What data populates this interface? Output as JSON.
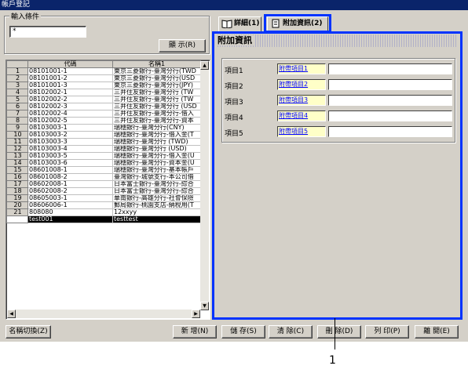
{
  "window": {
    "title": "帳戶登記"
  },
  "filter": {
    "group_title": "輸入條件",
    "value": "*",
    "display_button": "顯 示(R)"
  },
  "grid": {
    "headers": [
      "代碼",
      "名稱1"
    ],
    "rows": [
      {
        "num": "1",
        "code": "08101001-1",
        "name": "東京三菱銀行-臺灣分行(TWD"
      },
      {
        "num": "2",
        "code": "08101001-2",
        "name": "東京三菱銀行-臺灣分行(USD"
      },
      {
        "num": "3",
        "code": "08101001-3",
        "name": "東京三菱銀行-臺灣分行(JPY)"
      },
      {
        "num": "4",
        "code": "08102002-1",
        "name": "三井住友銀行-臺灣分行 (TW"
      },
      {
        "num": "5",
        "code": "08102002-2",
        "name": "三井住友銀行-臺灣分行 (TW"
      },
      {
        "num": "6",
        "code": "08102002-3",
        "name": "三井住友銀行-臺灣分行 (USD"
      },
      {
        "num": "7",
        "code": "08102002-4",
        "name": "三井住友銀行-臺灣分行-借入"
      },
      {
        "num": "8",
        "code": "08102002-5",
        "name": "三井住友銀行-臺灣分行-資本"
      },
      {
        "num": "9",
        "code": "08103003-1",
        "name": "瑞穗銀行-臺灣分行(CNY)"
      },
      {
        "num": "10",
        "code": "08103003-2",
        "name": "瑞穗銀行-臺灣分行-借入金(T"
      },
      {
        "num": "11",
        "code": "08103003-3",
        "name": "瑞穗銀行-臺灣分行 (TWD)"
      },
      {
        "num": "12",
        "code": "08103003-4",
        "name": "瑞穗銀行-臺灣分行 (USD)"
      },
      {
        "num": "13",
        "code": "08103003-5",
        "name": "瑞穗銀行-臺灣分行-借入金(U"
      },
      {
        "num": "14",
        "code": "08103003-6",
        "name": "瑞穗銀行-臺灣分行-資本金(U"
      },
      {
        "num": "15",
        "code": "08601008-1",
        "name": "瑞穗銀行-臺灣分行-基本帳戶"
      },
      {
        "num": "16",
        "code": "08601008-2",
        "name": "臺灣銀行-城號支行-本公司借"
      },
      {
        "num": "17",
        "code": "08602008-1",
        "name": "日本富士銀行-臺灣分行-綜合"
      },
      {
        "num": "18",
        "code": "08602008-2",
        "name": "日本富士銀行-臺灣分行-綜合"
      },
      {
        "num": "19",
        "code": "08605003-1",
        "name": "華南銀行-高雄分行-社會保險"
      },
      {
        "num": "20",
        "code": "08606006-1",
        "name": "郵局銀行-桃園支店-納稅用(T"
      },
      {
        "num": "21",
        "code": "808080",
        "name": "12xxyy"
      },
      {
        "num": "",
        "code": "test001",
        "name": "testtest"
      }
    ]
  },
  "tabs": [
    {
      "label": "詳細(1)"
    },
    {
      "label": "附加資訊(2)"
    }
  ],
  "panel": {
    "header": "附加資訊",
    "fields": [
      {
        "label": "項目1",
        "name": "附帶項目1",
        "value": ""
      },
      {
        "label": "項目2",
        "name": "附帶項目2",
        "value": ""
      },
      {
        "label": "項目3",
        "name": "附帶項目3",
        "value": ""
      },
      {
        "label": "項目4",
        "name": "附帶項目4",
        "value": ""
      },
      {
        "label": "項目5",
        "name": "附帶項目5",
        "value": ""
      }
    ]
  },
  "buttons": {
    "switch_name": "名稱切換(Z)",
    "add": "新 增(N)",
    "save": "儲 存(S)",
    "clear": "清 除(C)",
    "delete": "刪 除(D)",
    "print": "列 印(P)",
    "exit": "離 開(E)"
  },
  "callout": {
    "number": "1"
  },
  "colors": {
    "highlight": "#0033ff",
    "titlebar": "#0a246a",
    "field_name_bg": "#ffffc8"
  }
}
